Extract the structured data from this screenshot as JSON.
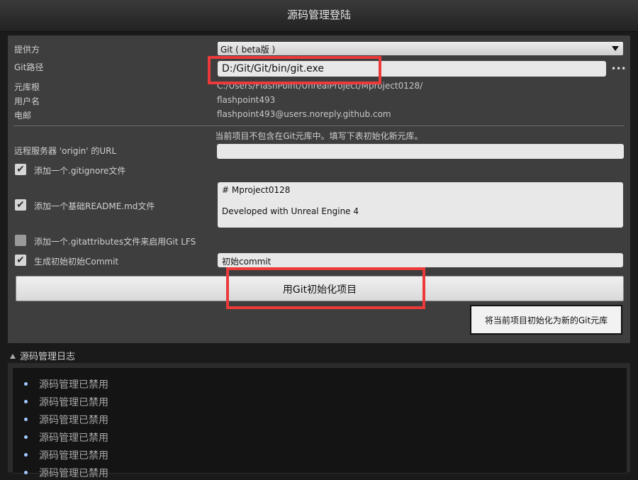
{
  "window": {
    "title": "源码管理登陆"
  },
  "form": {
    "provider_label": "提供方",
    "provider_value": "Git ( beta版 )",
    "git_path_label": "Git路径",
    "git_path_value": "D:/Git/Git/bin/git.exe",
    "browse_label": "•••",
    "repo_root_label": "元库根",
    "repo_root_value": "C:/Users/FlashPoint/UnrealProject/Mproject0128/",
    "user_label": "用户名",
    "user_value": "flashpoint493",
    "email_label": "电邮",
    "email_value": "flashpoint493@users.noreply.github.com",
    "notice": "当前项目不包含在Git元库中。填写下表初始化新元库。",
    "remote_url_label": "远程服务器 'origin' 的URL",
    "remote_url_value": "",
    "gitignore_label": "添加一个.gitignore文件",
    "gitignore_checked": true,
    "readme_label": "添加一个基础README.md文件",
    "readme_checked": true,
    "readme_line1": "# Mproject0128",
    "readme_line2": "Developed with Unreal Engine 4",
    "gitattributes_label": "添加一个.gitattributes文件来启用Git LFS",
    "gitattributes_checked": false,
    "initial_commit_label": "生成初始初始Commit",
    "initial_commit_checked": true,
    "initial_commit_value": "初始commit",
    "init_button_label": "用Git初始化项目",
    "init_repo_button_label": "将当前项目初始化为新的Git元库",
    "check_mark": "✔"
  },
  "log": {
    "title": "源码管理日志",
    "items": [
      "源码管理已禁用",
      "源码管理已禁用",
      "源码管理已禁用",
      "源码管理已禁用",
      "源码管理已禁用",
      "源码管理已禁用"
    ]
  },
  "colors": {
    "highlight": "#ec3a3a",
    "panel": "#3e3e3e",
    "background": "#1a1a1a"
  }
}
